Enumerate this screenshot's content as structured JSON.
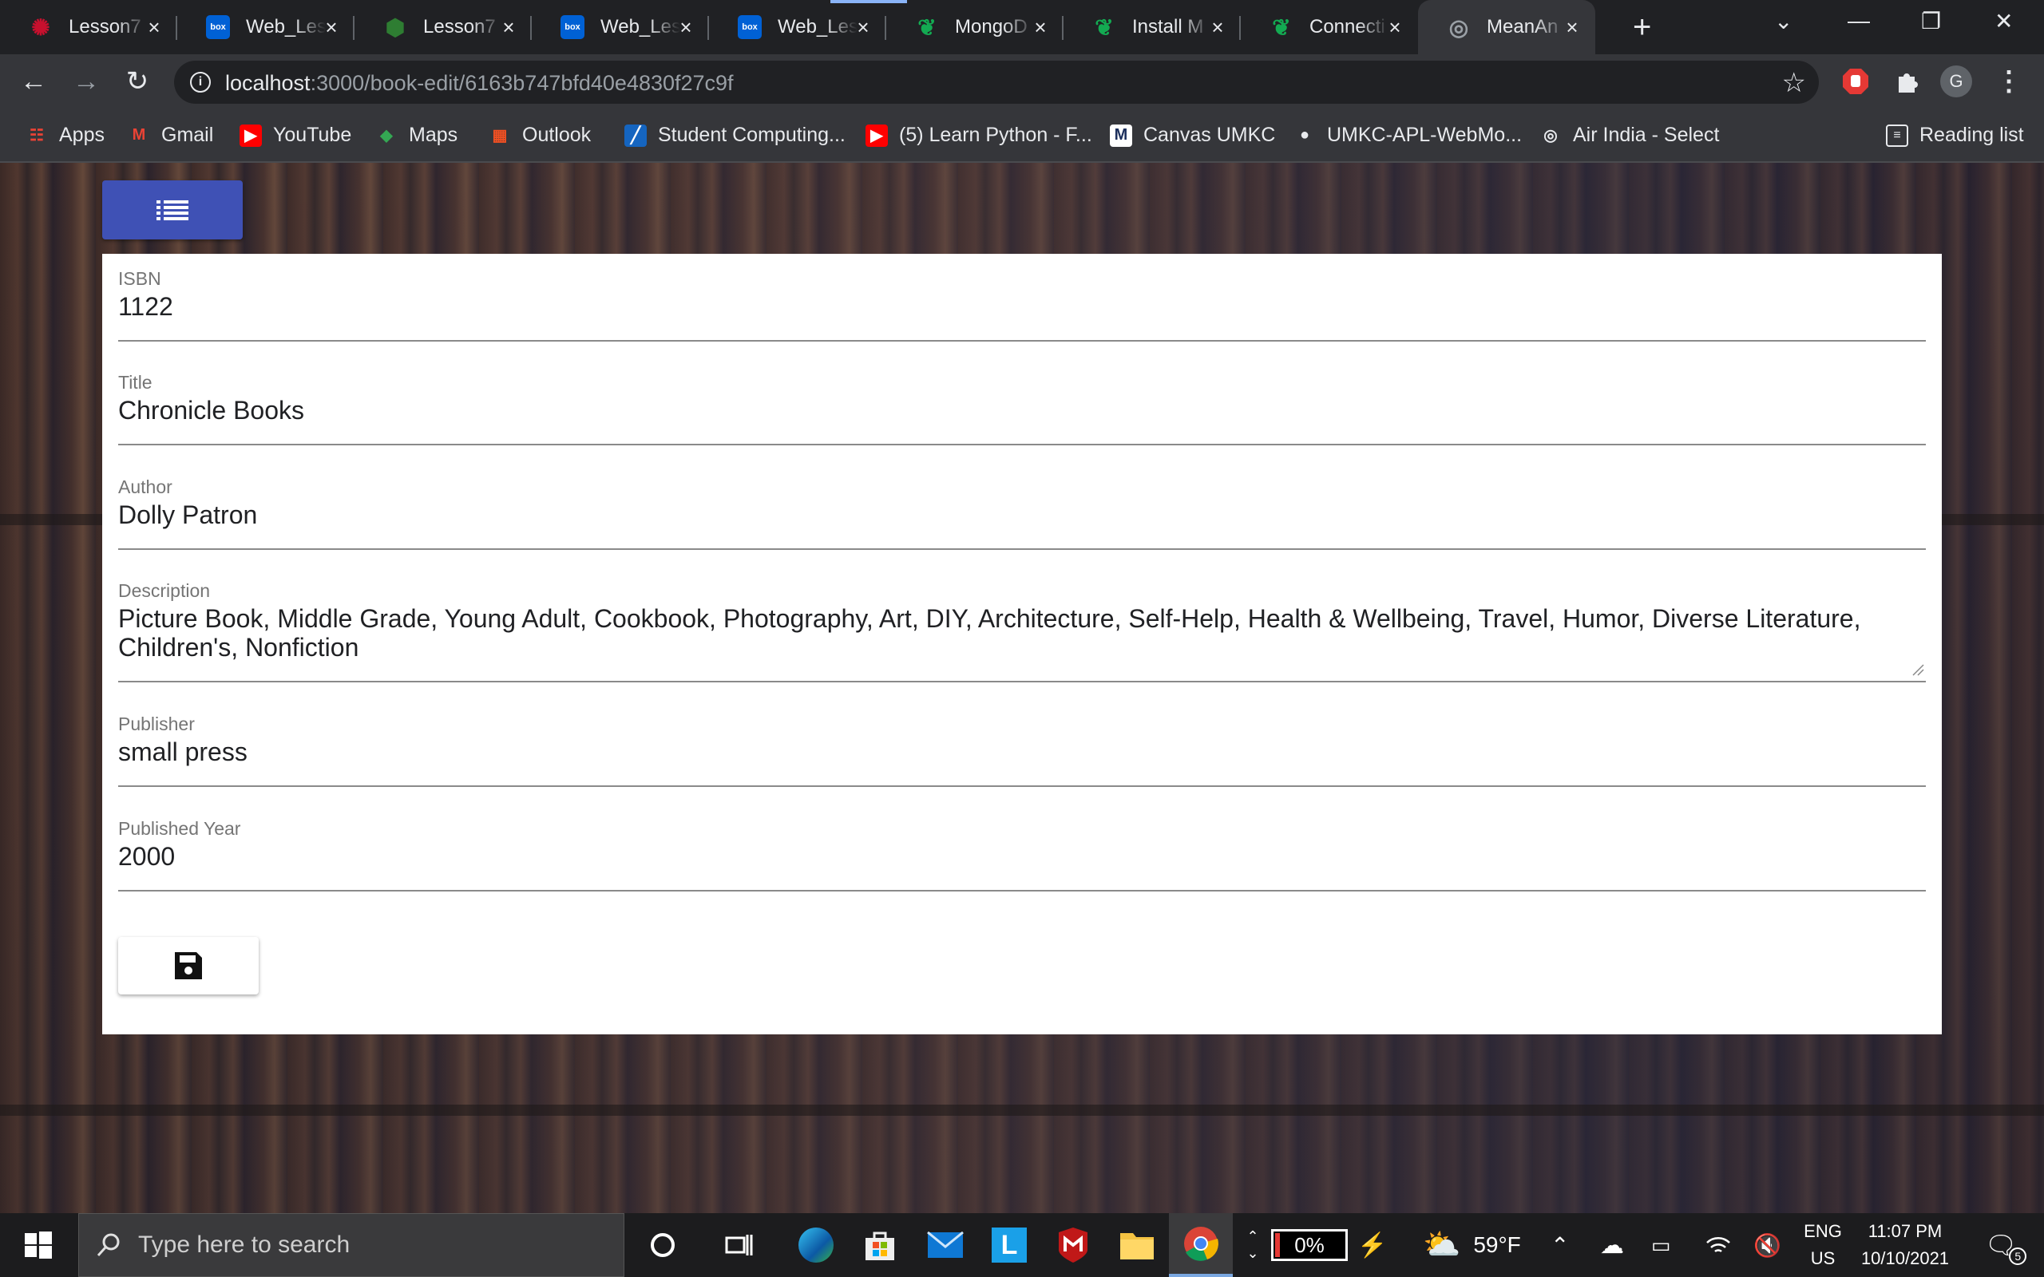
{
  "browser": {
    "tabs": [
      {
        "title": "Lesson7",
        "icon": "umkc-icon",
        "color": "#c8102e"
      },
      {
        "title": "Web_Les",
        "icon": "box-icon",
        "color": "#0061d5"
      },
      {
        "title": "Lesson7",
        "icon": "lesson-icon",
        "color": "#2e7d32"
      },
      {
        "title": "Web_Les",
        "icon": "box-icon",
        "color": "#0061d5"
      },
      {
        "title": "Web_Les",
        "icon": "box-icon",
        "color": "#0061d5"
      },
      {
        "title": "MongoD",
        "icon": "mongodb-leaf-icon",
        "color": "#13aa52"
      },
      {
        "title": "Install M",
        "icon": "mongodb-leaf-icon",
        "color": "#13aa52"
      },
      {
        "title": "Connecti",
        "icon": "mongodb-leaf-icon",
        "color": "#13aa52"
      },
      {
        "title": "MeanAn",
        "icon": "globe-icon",
        "color": "#9aa0a6",
        "active": true
      }
    ],
    "url_host": "localhost",
    "url_path": ":3000/book-edit/6163b747bfd40e4830f27c9f",
    "profile_initial": "G",
    "bookmarks": [
      {
        "label": "Apps",
        "icon": "apps-grid-icon"
      },
      {
        "label": "Gmail",
        "icon": "gmail-icon"
      },
      {
        "label": "YouTube",
        "icon": "youtube-icon"
      },
      {
        "label": "Maps",
        "icon": "maps-icon"
      },
      {
        "label": "Outlook",
        "icon": "outlook-icon"
      },
      {
        "label": "Student Computing...",
        "icon": "student-computing-icon"
      },
      {
        "label": "(5) Learn Python - F...",
        "icon": "youtube-icon"
      },
      {
        "label": "Canvas UMKC",
        "icon": "canvas-icon"
      },
      {
        "label": "UMKC-APL-WebMo...",
        "icon": "github-icon"
      },
      {
        "label": "Air India - Select",
        "icon": "globe-icon"
      }
    ],
    "reading_list": "Reading list"
  },
  "form": {
    "isbn": {
      "label": "ISBN",
      "value": "1122"
    },
    "title": {
      "label": "Title",
      "value": "Chronicle Books"
    },
    "author": {
      "label": "Author",
      "value": "Dolly Patron"
    },
    "description": {
      "label": "Description",
      "value": "Picture Book, Middle Grade, Young Adult, Cookbook, Photography, Art, DIY, Architecture, Self-Help, Health & Wellbeing, Travel, Humor, Diverse Literature, Children's, Nonfiction"
    },
    "publisher": {
      "label": "Publisher",
      "value": "small press"
    },
    "published_year": {
      "label": "Published Year",
      "value": "2000"
    }
  },
  "theme": {
    "primary": "#3f51b5"
  },
  "taskbar": {
    "search_placeholder": "Type here to search",
    "battery": "0%",
    "weather": "59°F",
    "lang_top": "ENG",
    "lang_bottom": "US",
    "time": "11:07 PM",
    "date": "10/10/2021",
    "notification_count": "5"
  }
}
